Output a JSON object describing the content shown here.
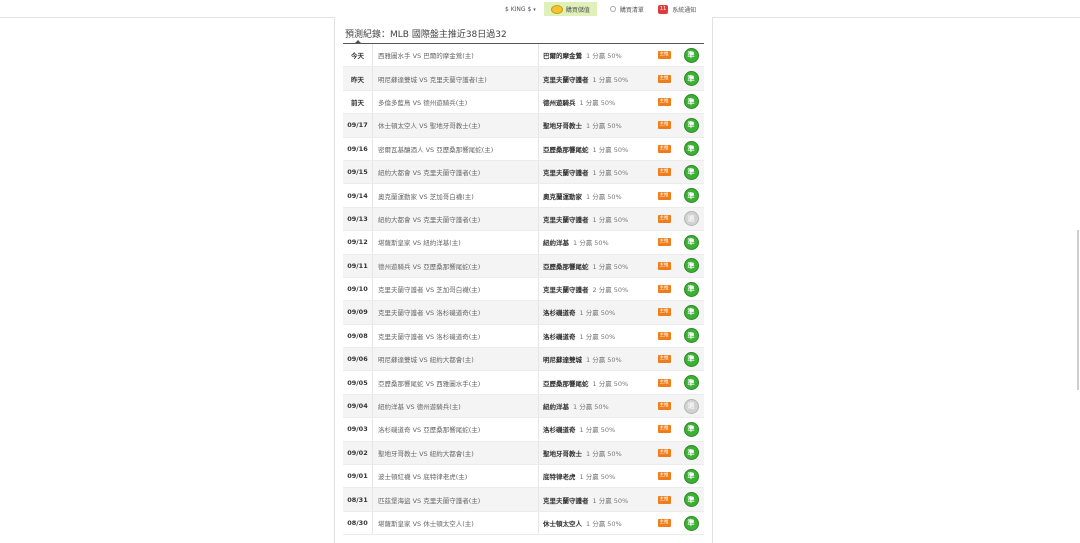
{
  "topbar": {
    "user_label": "$ KING $",
    "user_caret": "▾",
    "buy_label": "購買儲值",
    "record_label": "購買清單",
    "notify_count": "11",
    "notify_label": "系統通知"
  },
  "heading": "預測紀錄：MLB 國際盤主推近38日過32",
  "row_tag_label": "主推",
  "rows": [
    {
      "date": "今天",
      "match": "西雅圖水手 VS 巴爾的摩金鶯(主)",
      "pick": "巴爾的摩金鶯",
      "odds": "1 分贏 50%",
      "result": "準"
    },
    {
      "date": "昨天",
      "match": "明尼蘇達雙城 VS 克里夫蘭守護者(主)",
      "pick": "克里夫蘭守護者",
      "odds": "1 分贏 50%",
      "result": "準"
    },
    {
      "date": "前天",
      "match": "多倫多藍鳥 VS 德州遊騎兵(主)",
      "pick": "德州遊騎兵",
      "odds": "1 分贏 50%",
      "result": "準"
    },
    {
      "date": "09/17",
      "match": "休士頓太空人 VS 聖地牙哥教士(主)",
      "pick": "聖地牙哥教士",
      "odds": "1 分贏 50%",
      "result": "準"
    },
    {
      "date": "09/16",
      "match": "密爾瓦基釀酒人 VS 亞歷桑那響尾蛇(主)",
      "pick": "亞歷桑那響尾蛇",
      "odds": "1 分贏 50%",
      "result": "準"
    },
    {
      "date": "09/15",
      "match": "紐約大都會 VS 克里夫蘭守護者(主)",
      "pick": "克里夫蘭守護者",
      "odds": "1 分贏 50%",
      "result": "準"
    },
    {
      "date": "09/14",
      "match": "奧克蘭運動家 VS 芝加哥白襪(主)",
      "pick": "奧克蘭運動家",
      "odds": "1 分贏 50%",
      "result": "準"
    },
    {
      "date": "09/13",
      "match": "紐約大都會 VS 克里夫蘭守護者(主)",
      "pick": "克里夫蘭守護者",
      "odds": "1 分贏 50%",
      "result": "退"
    },
    {
      "date": "09/12",
      "match": "堪薩斯皇家 VS 紐約洋基(主)",
      "pick": "紐約洋基",
      "odds": "1 分贏 50%",
      "result": "準"
    },
    {
      "date": "09/11",
      "match": "德州遊騎兵 VS 亞歷桑那響尾蛇(主)",
      "pick": "亞歷桑那響尾蛇",
      "odds": "1 分贏 50%",
      "result": "準"
    },
    {
      "date": "09/10",
      "match": "克里夫蘭守護者 VS 芝加哥白襪(主)",
      "pick": "克里夫蘭守護者",
      "odds": "2 分贏 50%",
      "result": "準"
    },
    {
      "date": "09/09",
      "match": "克里夫蘭守護者 VS 洛杉磯道奇(主)",
      "pick": "洛杉磯道奇",
      "odds": "1 分贏 50%",
      "result": "準"
    },
    {
      "date": "09/08",
      "match": "克里夫蘭守護者 VS 洛杉磯道奇(主)",
      "pick": "洛杉磯道奇",
      "odds": "1 分贏 50%",
      "result": "準"
    },
    {
      "date": "09/06",
      "match": "明尼蘇達雙城 VS 紐約大都會(主)",
      "pick": "明尼蘇達雙城",
      "odds": "1 分贏 50%",
      "result": "準"
    },
    {
      "date": "09/05",
      "match": "亞歷桑那響尾蛇 VS 西雅圖水手(主)",
      "pick": "亞歷桑那響尾蛇",
      "odds": "1 分贏 50%",
      "result": "準"
    },
    {
      "date": "09/04",
      "match": "紐約洋基 VS 德州遊騎兵(主)",
      "pick": "紐約洋基",
      "odds": "1 分贏 50%",
      "result": "退"
    },
    {
      "date": "09/03",
      "match": "洛杉磯道奇 VS 亞歷桑那響尾蛇(主)",
      "pick": "洛杉磯道奇",
      "odds": "1 分贏 50%",
      "result": "準"
    },
    {
      "date": "09/02",
      "match": "聖地牙哥教士 VS 紐約大都會(主)",
      "pick": "聖地牙哥教士",
      "odds": "1 分贏 50%",
      "result": "準"
    },
    {
      "date": "09/01",
      "match": "波士頓紅襪 VS 底特律老虎(主)",
      "pick": "底特律老虎",
      "odds": "1 分贏 50%",
      "result": "準"
    },
    {
      "date": "08/31",
      "match": "匹茲堡海盜 VS 克里夫蘭守護者(主)",
      "pick": "克里夫蘭守護者",
      "odds": "1 分贏 50%",
      "result": "準"
    },
    {
      "date": "08/30",
      "match": "堪薩斯皇家 VS 休士頓太空人(主)",
      "pick": "休士頓太空人",
      "odds": "1 分贏 50%",
      "result": "準"
    }
  ]
}
